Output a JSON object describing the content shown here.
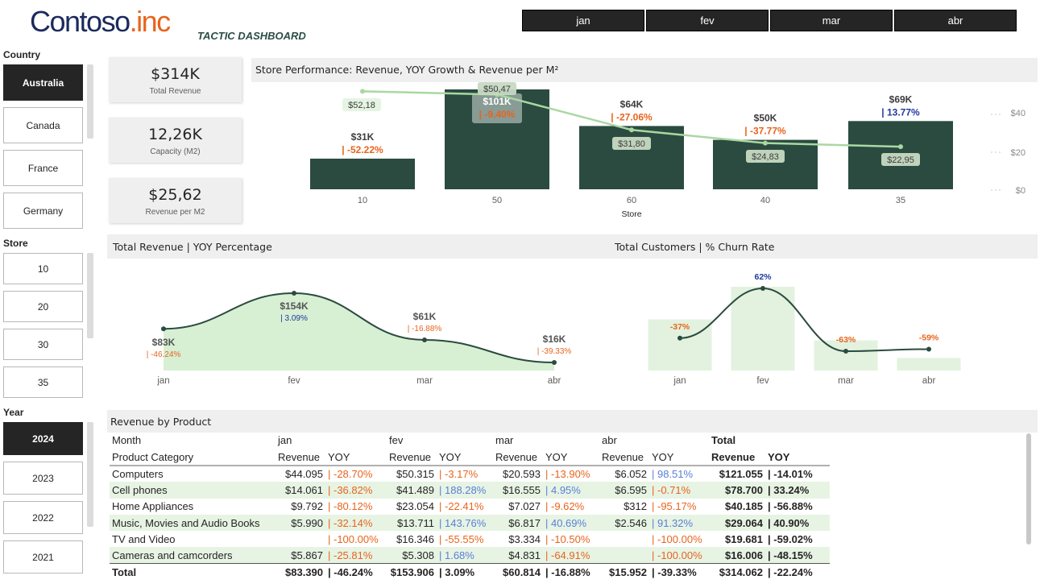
{
  "header": {
    "logo_main": "Contoso",
    "logo_suffix": ".inc",
    "dashboard_title": "TACTIC DASHBOARD",
    "months": [
      "jan",
      "fev",
      "mar",
      "abr"
    ]
  },
  "slicers": {
    "country": {
      "title": "Country",
      "options": [
        "Australia",
        "Canada",
        "France",
        "Germany"
      ],
      "selected": "Australia"
    },
    "store": {
      "title": "Store",
      "options": [
        "10",
        "20",
        "30",
        "35"
      ]
    },
    "year": {
      "title": "Year",
      "options": [
        "2024",
        "2023",
        "2022",
        "2021"
      ],
      "selected": "2024"
    }
  },
  "kpis": [
    {
      "value": "$314K",
      "caption": "Total Revenue"
    },
    {
      "value": "12,26K",
      "caption": "Capacity (M2)"
    },
    {
      "value": "$25,62",
      "caption": "Revenue per M2"
    }
  ],
  "colors": {
    "bar": "#2b4b40",
    "line_light": "#a9d8a1",
    "area_fill": "#d7efd3",
    "negative": "#e8641c",
    "positive": "#1f3a9e",
    "churn_bar": "#e3f2df",
    "line_dark": "#2b4b40"
  },
  "chart_data": [
    {
      "type": "bar",
      "title": "Store Performance: Revenue, YOY Growth & Revenue per M²",
      "xlabel": "Store",
      "categories": [
        "10",
        "50",
        "60",
        "40",
        "35"
      ],
      "series": [
        {
          "values": [
            31,
            101,
            64,
            50,
            69
          ],
          "labels": [
            "$31K",
            "$101K",
            "$64K",
            "$50K",
            "$69K"
          ]
        },
        {
          "values": [
            -52.22,
            -9.4,
            -27.06,
            -37.77,
            13.77
          ],
          "labels": [
            "| -52.22%",
            "| -9.40%",
            "| -27.06%",
            "| -37.77%",
            "| 13.77%"
          ]
        },
        {
          "values": [
            52.18,
            50.47,
            31.8,
            24.83,
            22.95
          ],
          "labels": [
            "$52,18",
            "$50,47",
            "$31,80",
            "$24,83",
            "$22,95"
          ]
        }
      ],
      "y2_ticks": [
        "$40",
        "$20",
        "$0"
      ],
      "y2lim": [
        0,
        40
      ]
    },
    {
      "type": "area",
      "title": "Total Revenue | YOY Percentage",
      "categories": [
        "jan",
        "fev",
        "mar",
        "abr"
      ],
      "series": [
        {
          "values": [
            83,
            154,
            61,
            16
          ],
          "labels": [
            "$83K",
            "$154K",
            "$61K",
            "$16K"
          ]
        },
        {
          "values": [
            -46.24,
            3.09,
            -16.88,
            -39.33
          ],
          "labels": [
            "| -46.24%",
            "| 3.09%",
            "| -16.88%",
            "| -39.33%"
          ]
        }
      ]
    },
    {
      "type": "bar",
      "title": "Total Customers | % Churn Rate",
      "categories": [
        "jan",
        "fev",
        "mar",
        "abr"
      ],
      "series": [
        {
          "values": [
            0.61,
            1.0,
            0.36,
            0.15
          ]
        },
        {
          "values": [
            -37,
            62,
            -63,
            -59
          ],
          "labels": [
            "-37%",
            "62%",
            "-63%",
            "-59%"
          ]
        }
      ]
    }
  ],
  "table": {
    "title": "Revenue by Product",
    "header_row1": [
      "Month",
      "jan",
      "",
      "fev",
      "",
      "mar",
      "",
      "abr",
      "",
      "Total",
      ""
    ],
    "header_row2": [
      "Product Category",
      "Revenue",
      "YOY",
      "Revenue",
      "YOY",
      "Revenue",
      "YOY",
      "Revenue",
      "YOY",
      "Revenue",
      "YOY"
    ],
    "rows": [
      [
        "Computers",
        "$44.095",
        "| -28.70%",
        "$50.315",
        "| -3.17%",
        "$20.593",
        "| -13.90%",
        "$6.052",
        "| 98.51%",
        "$121.055",
        "| -14.01%"
      ],
      [
        "Cell phones",
        "$14.061",
        "| -36.82%",
        "$41.489",
        "| 188.28%",
        "$16.555",
        "| 4.95%",
        "$6.595",
        "| -0.71%",
        "$78.700",
        "| 33.24%"
      ],
      [
        "Home Appliances",
        "$9.792",
        "| -80.12%",
        "$23.054",
        "| -22.41%",
        "$7.027",
        "| -9.62%",
        "$312",
        "| -95.17%",
        "$40.185",
        "| -56.88%"
      ],
      [
        "Music, Movies and Audio Books",
        "$5.990",
        "| -32.14%",
        "$13.711",
        "| 143.76%",
        "$6.817",
        "| 40.69%",
        "$2.546",
        "| 91.32%",
        "$29.064",
        "| 40.90%"
      ],
      [
        "TV and Video",
        "",
        "| -100.00%",
        "$16.346",
        "| -55.55%",
        "$3.334",
        "| -10.50%",
        "",
        "| -100.00%",
        "$19.681",
        "| -59.02%"
      ],
      [
        "Cameras and camcorders",
        "$5.867",
        "| -25.81%",
        "$5.308",
        "| 1.68%",
        "$4.831",
        "| -64.91%",
        "",
        "| -100.00%",
        "$16.006",
        "| -48.15%"
      ]
    ],
    "total": [
      "Total",
      "$83.390",
      "| -46.24%",
      "$153.906",
      "| 3.09%",
      "$60.814",
      "| -16.88%",
      "$15.952",
      "| -39.33%",
      "$314.062",
      "| -22.24%"
    ]
  }
}
